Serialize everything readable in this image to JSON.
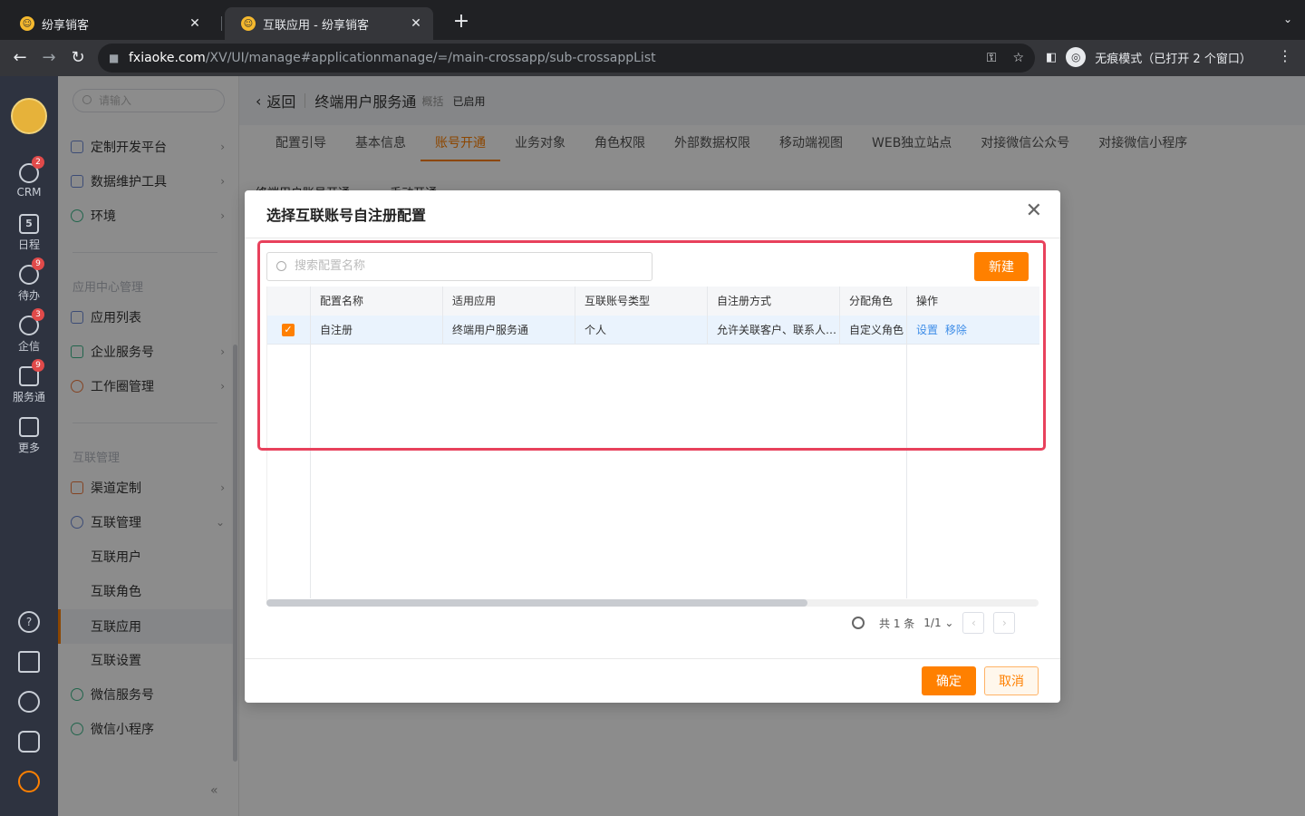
{
  "browser": {
    "tabs": [
      {
        "title": "纷享销客",
        "active": false
      },
      {
        "title": "互联应用 - 纷享销客",
        "active": true
      }
    ],
    "url_host": "fxiaoke.com",
    "url_path": "/XV/UI/manage#applicationmanage/=/main-crossapp/sub-crossappList",
    "incognito_label": "无痕模式（已打开 2 个窗口）"
  },
  "rail": {
    "items": [
      {
        "label": "CRM",
        "badge": "2"
      },
      {
        "label": "日程",
        "badge": "",
        "day": "5"
      },
      {
        "label": "待办",
        "badge": "9"
      },
      {
        "label": "企信",
        "badge": "3"
      },
      {
        "label": "服务通",
        "badge": "9"
      },
      {
        "label": "更多",
        "badge": ""
      }
    ],
    "help_glyph": "?"
  },
  "sidemenu": {
    "search_placeholder": "请输入",
    "items_top": [
      {
        "label": "定制开发平台"
      },
      {
        "label": "数据维护工具"
      },
      {
        "label": "环境"
      }
    ],
    "group_app_center": "应用中心管理",
    "items_app": [
      {
        "label": "应用列表"
      },
      {
        "label": "企业服务号"
      },
      {
        "label": "工作圈管理"
      }
    ],
    "group_interconnect": "互联管理",
    "items_inter": [
      {
        "label": "渠道定制"
      },
      {
        "label": "互联管理"
      }
    ],
    "sub_items": [
      {
        "label": "互联用户"
      },
      {
        "label": "互联角色"
      },
      {
        "label": "互联应用"
      },
      {
        "label": "互联设置"
      }
    ],
    "items_wechat": [
      {
        "label": "微信服务号"
      },
      {
        "label": "微信小程序"
      }
    ],
    "collapse_glyph": "«"
  },
  "main": {
    "back": "返回",
    "app_name": "终端用户服务通",
    "app_sub": "概括",
    "status": "已启用",
    "tabs": [
      "配置引导",
      "基本信息",
      "账号开通",
      "业务对象",
      "角色权限",
      "外部数据权限",
      "移动端视图",
      "WEB独立站点",
      "对接微信公众号",
      "对接微信小程序"
    ],
    "active_tab": "账号开通",
    "peek_label": "终端用户账号开通",
    "peek_value": "手动开通"
  },
  "modal": {
    "title": "选择互联账号自注册配置",
    "search_placeholder": "搜索配置名称",
    "new_button": "新建",
    "columns": [
      "配置名称",
      "适用应用",
      "互联账号类型",
      "自注册方式",
      "分配角色",
      "操作"
    ],
    "rows": [
      {
        "name": "自注册",
        "app": "终端用户服务通",
        "type": "个人",
        "method": "允许关联客户、联系人…",
        "role": "自定义角色",
        "actions": [
          "设置",
          "移除"
        ],
        "checked": true
      }
    ],
    "pager_total": "共 1 条",
    "pager_page": "1/1",
    "ok_button": "确定",
    "cancel_button": "取消"
  }
}
